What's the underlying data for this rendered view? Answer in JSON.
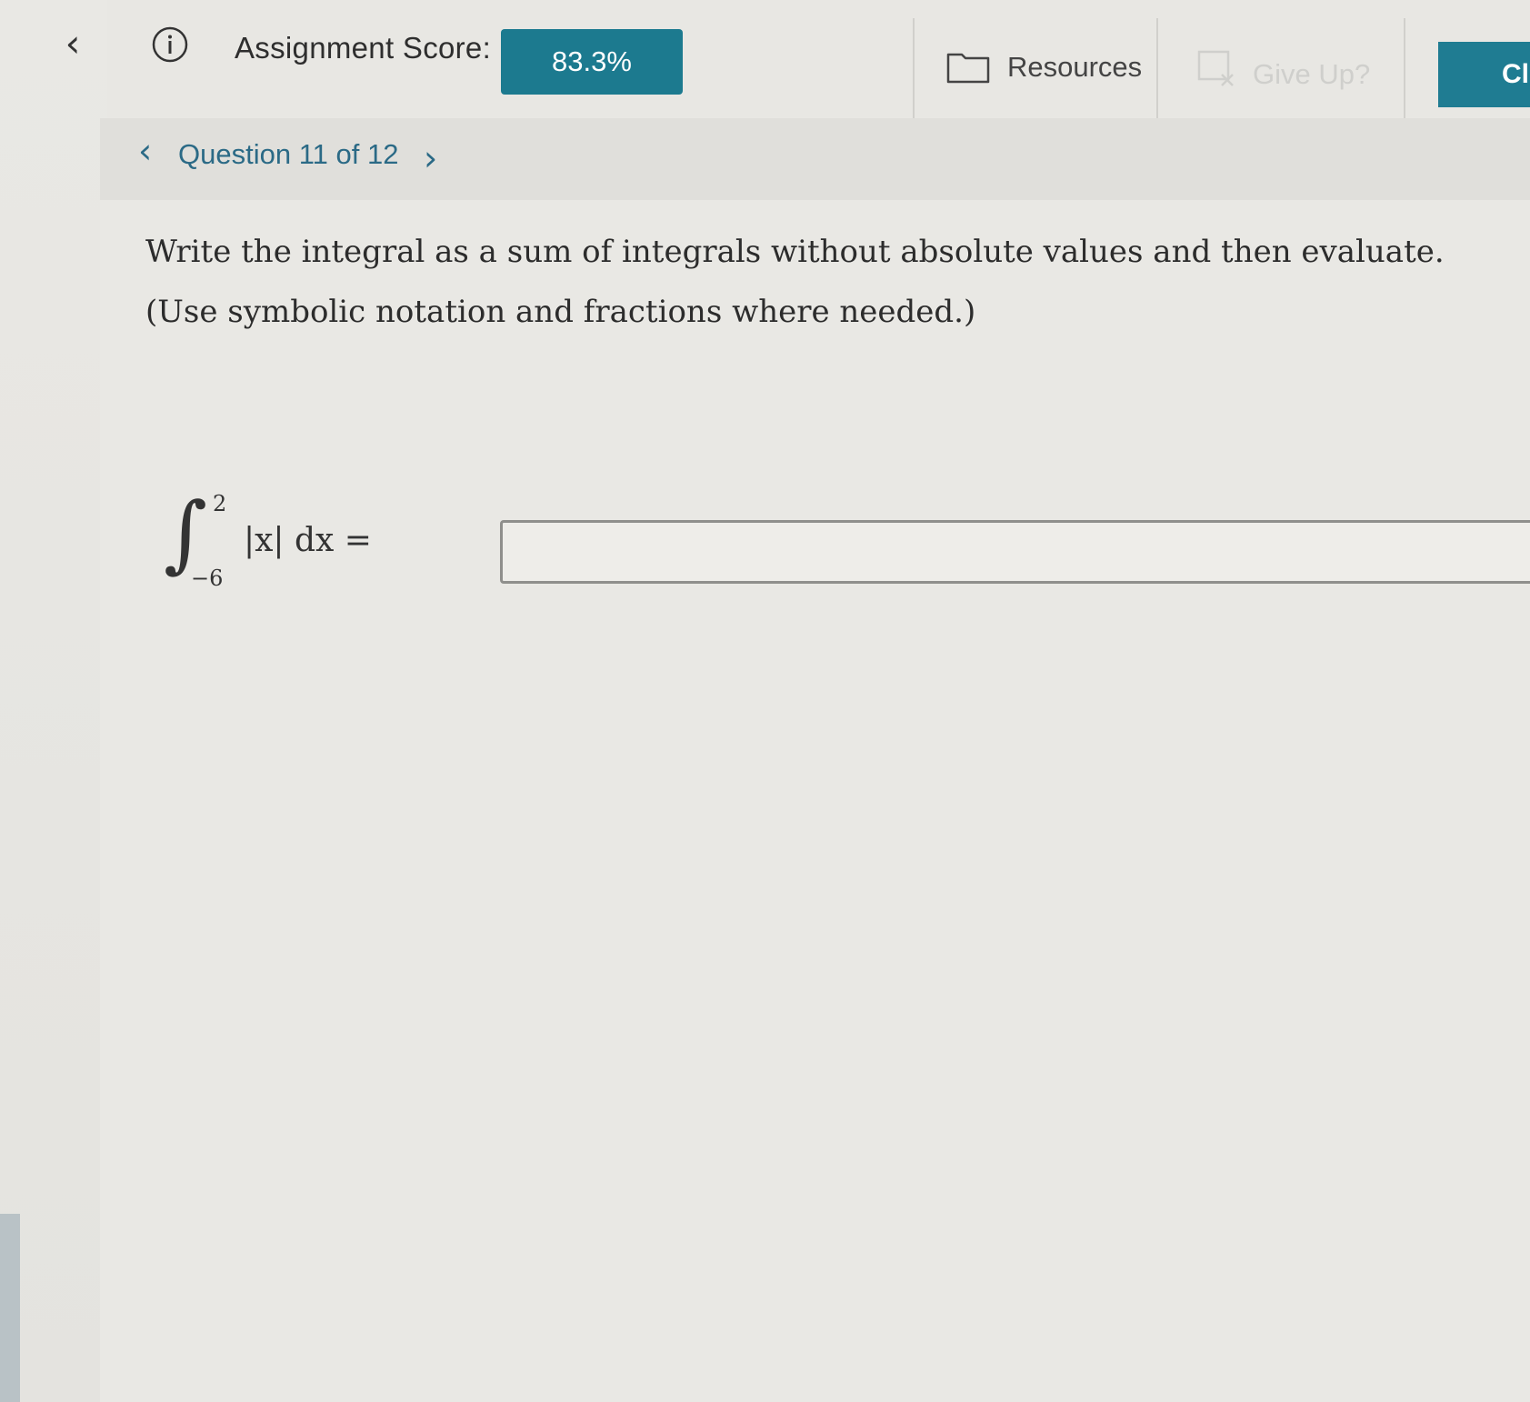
{
  "header": {
    "back_icon": "chevron-left-icon",
    "info_icon": "info-circle-icon",
    "assignment_score_label": "Assignment Score:",
    "assignment_score_value": "83.3%",
    "resources_label": "Resources",
    "resources_icon": "folder-icon",
    "give_up_label": "Give Up?",
    "give_up_icon": "give-up-icon",
    "check_label": "Cl",
    "accent_color": "#1c7a8f"
  },
  "question_nav": {
    "label": "Question 11 of 12",
    "prev_icon": "chevron-left-icon",
    "next_icon": "chevron-right-icon",
    "link_color": "#2b6a86"
  },
  "question": {
    "prompt_line1": "Write the integral as a sum of integrals without absolute values and then evaluate.",
    "prompt_line2": "(Use symbolic notation and fractions where needed.)",
    "integral_lower": "−6",
    "integral_upper": "2",
    "integrand": "|x| dx =",
    "answer_value": ""
  }
}
